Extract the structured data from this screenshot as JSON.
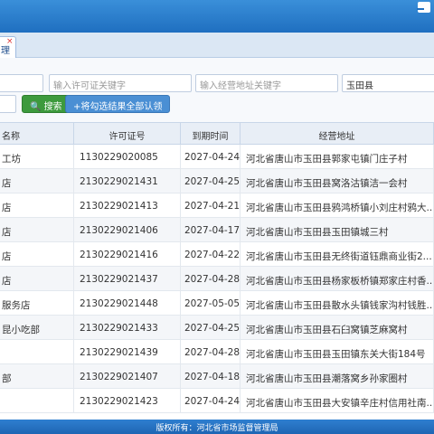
{
  "tab": {
    "label": "理"
  },
  "filters": {
    "license_placeholder": "输入许可证关键字",
    "address_placeholder": "输入经营地址关键字",
    "county_value": "玉田县",
    "search_label": "搜索",
    "confirm_label": "+将勾选结果全部认领"
  },
  "columns": {
    "name": "名称",
    "license": "许可证号",
    "expiry": "到期时间",
    "address": "经营地址"
  },
  "rows": [
    {
      "name": "工坊",
      "license": "1130229020085",
      "expiry": "2027-04-24",
      "address": "河北省唐山市玉田县郭家屯镇门庄子村"
    },
    {
      "name": "店",
      "license": "2130229021431",
      "expiry": "2027-04-25",
      "address": "河北省唐山市玉田县窝洛沽镇洁一会村"
    },
    {
      "name": "店",
      "license": "2130229021413",
      "expiry": "2027-04-21",
      "address": "河北省唐山市玉田县鸦鸿桥镇小刘庄村鸦大..."
    },
    {
      "name": "店",
      "license": "2130229021406",
      "expiry": "2027-04-17",
      "address": "河北省唐山市玉田县玉田镇城三村"
    },
    {
      "name": "店",
      "license": "2130229021416",
      "expiry": "2027-04-22",
      "address": "河北省唐山市玉田县无终街道钰鼎商业街2..."
    },
    {
      "name": "店",
      "license": "2130229021437",
      "expiry": "2027-04-28",
      "address": "河北省唐山市玉田县杨家板桥镇郑家庄村香..."
    },
    {
      "name": "服务店",
      "license": "2130229021448",
      "expiry": "2027-05-05",
      "address": "河北省唐山市玉田县散水头镇钱家沟村钱胜..."
    },
    {
      "name": "昆小吃部",
      "license": "2130229021433",
      "expiry": "2027-04-25",
      "address": "河北省唐山市玉田县石臼窝镇芝麻窝村"
    },
    {
      "name": "",
      "license": "2130229021439",
      "expiry": "2027-04-28",
      "address": "河北省唐山市玉田县玉田镇东关大街184号"
    },
    {
      "name": "部",
      "license": "2130229021407",
      "expiry": "2027-04-18",
      "address": "河北省唐山市玉田县潮落窝乡孙家圈村"
    },
    {
      "name": "",
      "license": "2130229021423",
      "expiry": "2027-04-24",
      "address": "河北省唐山市玉田县大安镇辛庄村信用社南..."
    }
  ],
  "footer": {
    "text": "版权所有：河北省市场监督管理局"
  }
}
